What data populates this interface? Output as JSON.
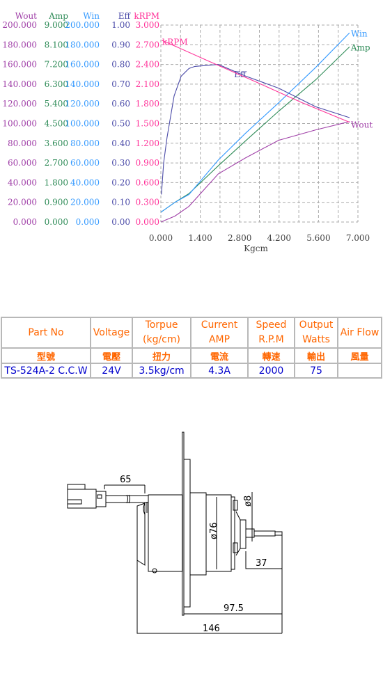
{
  "chart_data": {
    "type": "line",
    "xlabel": "Kgcm",
    "xlim": [
      0,
      7
    ],
    "x_ticks": [
      "0.000",
      "1.400",
      "2.800",
      "4.200",
      "5.600",
      "7.000"
    ],
    "grid": true,
    "y_axes": [
      {
        "name": "Wout",
        "color": "#a040a8",
        "max": 200,
        "ticks": [
          "0.000",
          "20.000",
          "40.000",
          "60.000",
          "80.000",
          "100.000",
          "120.000",
          "140.000",
          "160.000",
          "180.000",
          "200.000"
        ]
      },
      {
        "name": "Amp",
        "color": "#2e8b57",
        "max": 9,
        "ticks": [
          "0.000",
          "0.900",
          "1.800",
          "2.700",
          "3.600",
          "4.500",
          "5.400",
          "6.300",
          "7.200",
          "8.100",
          "9.000"
        ]
      },
      {
        "name": "Win",
        "color": "#3399ff",
        "max": 200,
        "ticks": [
          "0.000",
          "20.000",
          "40.000",
          "60.000",
          "80.000",
          "100.000",
          "120.000",
          "140.000",
          "160.000",
          "180.000",
          "200.000"
        ]
      },
      {
        "name": "Eff",
        "color": "#4b4ba8",
        "max": 1,
        "ticks": [
          "0.00",
          "0.10",
          "0.20",
          "0.30",
          "0.40",
          "0.50",
          "0.60",
          "0.70",
          "0.80",
          "0.90",
          "1.00"
        ]
      },
      {
        "name": "kRPM",
        "color": "#ff3399",
        "max": 3,
        "ticks": [
          "0.000",
          "0.300",
          "0.600",
          "0.900",
          "1.200",
          "1.500",
          "1.800",
          "2.100",
          "2.400",
          "2.700",
          "3.000"
        ]
      }
    ],
    "series": [
      {
        "name": "Wout",
        "axis": 0,
        "points": [
          [
            0,
            0
          ],
          [
            0.5,
            6
          ],
          [
            1,
            16
          ],
          [
            2.04,
            48.9
          ],
          [
            3,
            65
          ],
          [
            4.18,
            83
          ],
          [
            5.5,
            93.6
          ],
          [
            6.7,
            102
          ]
        ]
      },
      {
        "name": "Amp",
        "axis": 1,
        "points": [
          [
            0,
            0.45
          ],
          [
            0.5,
            0.9
          ],
          [
            1,
            1.3
          ],
          [
            2.04,
            2.57
          ],
          [
            3,
            3.7
          ],
          [
            4.18,
            5.06
          ],
          [
            5.5,
            6.5
          ],
          [
            6.7,
            8.0
          ]
        ]
      },
      {
        "name": "Win",
        "axis": 2,
        "points": [
          [
            0,
            10
          ],
          [
            0.5,
            20
          ],
          [
            1,
            28
          ],
          [
            2.04,
            63
          ],
          [
            3,
            90
          ],
          [
            4.18,
            121
          ],
          [
            5.5,
            157
          ],
          [
            6.7,
            192
          ]
        ]
      },
      {
        "name": "Eff",
        "axis": 3,
        "points": [
          [
            0.02,
            0.14
          ],
          [
            0.1,
            0.3
          ],
          [
            0.22,
            0.43
          ],
          [
            0.47,
            0.64
          ],
          [
            0.72,
            0.74
          ],
          [
            1.0,
            0.78
          ],
          [
            1.21,
            0.79
          ],
          [
            2.04,
            0.8
          ],
          [
            3.03,
            0.74
          ],
          [
            4.18,
            0.68
          ],
          [
            5.5,
            0.585
          ],
          [
            6.7,
            0.53
          ]
        ]
      },
      {
        "name": "kRPM",
        "axis": 4,
        "points": [
          [
            0.03,
            2.77
          ],
          [
            1.7,
            2.45
          ],
          [
            3.4,
            2.13
          ],
          [
            5.0,
            1.82
          ],
          [
            6.7,
            1.52
          ]
        ]
      }
    ]
  },
  "spec_table": {
    "headers": [
      "Part No",
      "Voltage",
      "Torpue (kg/cm)",
      "Current AMP",
      "Speed R.P.M",
      "Output Watts",
      "Air Flow"
    ],
    "headers_zh": [
      "型號",
      "電壓",
      "扭力",
      "電流",
      "轉速",
      "輸出",
      "風量"
    ],
    "values": [
      "TS-524A-2 C.C.W",
      "24V",
      "3.5kg/cm",
      "4.3A",
      "2000",
      "75",
      ""
    ]
  },
  "drawing": {
    "dim_lead": "65",
    "dim_diameter_body": "ø76",
    "dim_diameter_shaft": "ø8",
    "dim_shaft": "37",
    "dim_flange_to_tip": "97.5",
    "dim_total": "146"
  }
}
